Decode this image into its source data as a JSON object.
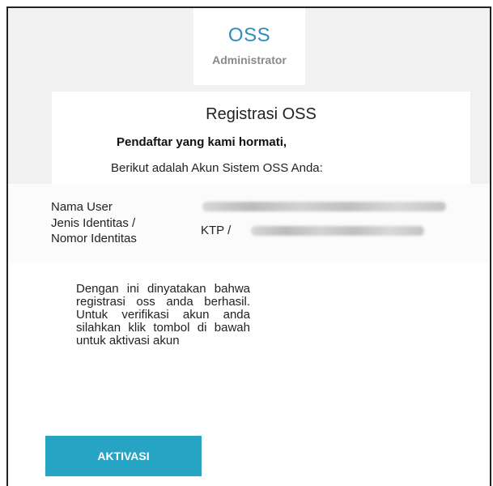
{
  "header": {
    "brand": "OSS",
    "subtitle": "Administrator"
  },
  "card": {
    "title": "Registrasi OSS",
    "greeting": "Pendaftar yang kami hormati,",
    "intro": "Berikut adalah Akun Sistem OSS Anda:"
  },
  "account": {
    "username_label": "Nama User",
    "identity_label_line1": "Jenis Identitas /",
    "identity_label_line2": "Nomor Identitas",
    "identity_value_prefix": "KTP /"
  },
  "message": "Dengan ini dinyatakan bahwa registrasi oss anda berhasil. Untuk verifikasi akun anda silahkan klik tombol di bawah untuk aktivasi akun",
  "actions": {
    "activate_label": "AKTIVASI"
  },
  "colors": {
    "brand": "#2a8fc0",
    "button": "#27a3c4",
    "page_bg": "#f1f1f1"
  }
}
